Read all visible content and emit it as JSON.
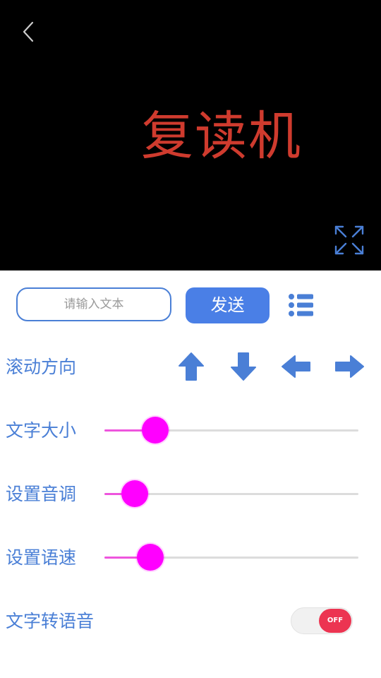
{
  "preview": {
    "display_text": "复读机",
    "text_color": "#cf3b2e",
    "background_color": "#000000",
    "back_icon": "chevron-left-icon",
    "fullscreen_icon": "expand-icon"
  },
  "input_bar": {
    "placeholder": "请输入文本",
    "value": "",
    "send_label": "发送",
    "list_icon": "list-icon"
  },
  "scroll_direction": {
    "label": "滚动方向",
    "options": [
      "up-arrow-icon",
      "down-arrow-icon",
      "left-arrow-icon",
      "right-arrow-icon"
    ]
  },
  "font_size": {
    "label": "文字大小",
    "value": 0.2
  },
  "pitch": {
    "label": "设置音调",
    "value": 0.12
  },
  "speed": {
    "label": "设置语速",
    "value": 0.18
  },
  "tts": {
    "label": "文字转语音",
    "state": "OFF",
    "enabled": false
  },
  "colors": {
    "accent": "#4a7fd6",
    "slider_thumb": "#ff00ff",
    "toggle_off": "#ec3451"
  }
}
